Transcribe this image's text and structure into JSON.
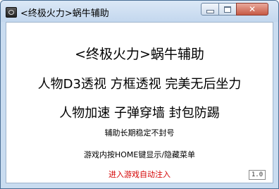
{
  "window": {
    "title": "<终极火力>蜗牛辅助"
  },
  "content": {
    "heading": "<终极火力>蜗牛辅助",
    "features_line1": "人物D3透视 方框透视 完美无后坐力",
    "features_line2": "人物加速 子弹穿墙 封包防踢",
    "note_stable": "辅助长期稳定不封号",
    "note_hotkey": "游戏内按HOME键显示/隐藏菜单",
    "status_inject": "进入游戏自动注入",
    "version": "1.0"
  },
  "colors": {
    "status_text": "#d40000",
    "titlebar": "#c9dcf0"
  }
}
